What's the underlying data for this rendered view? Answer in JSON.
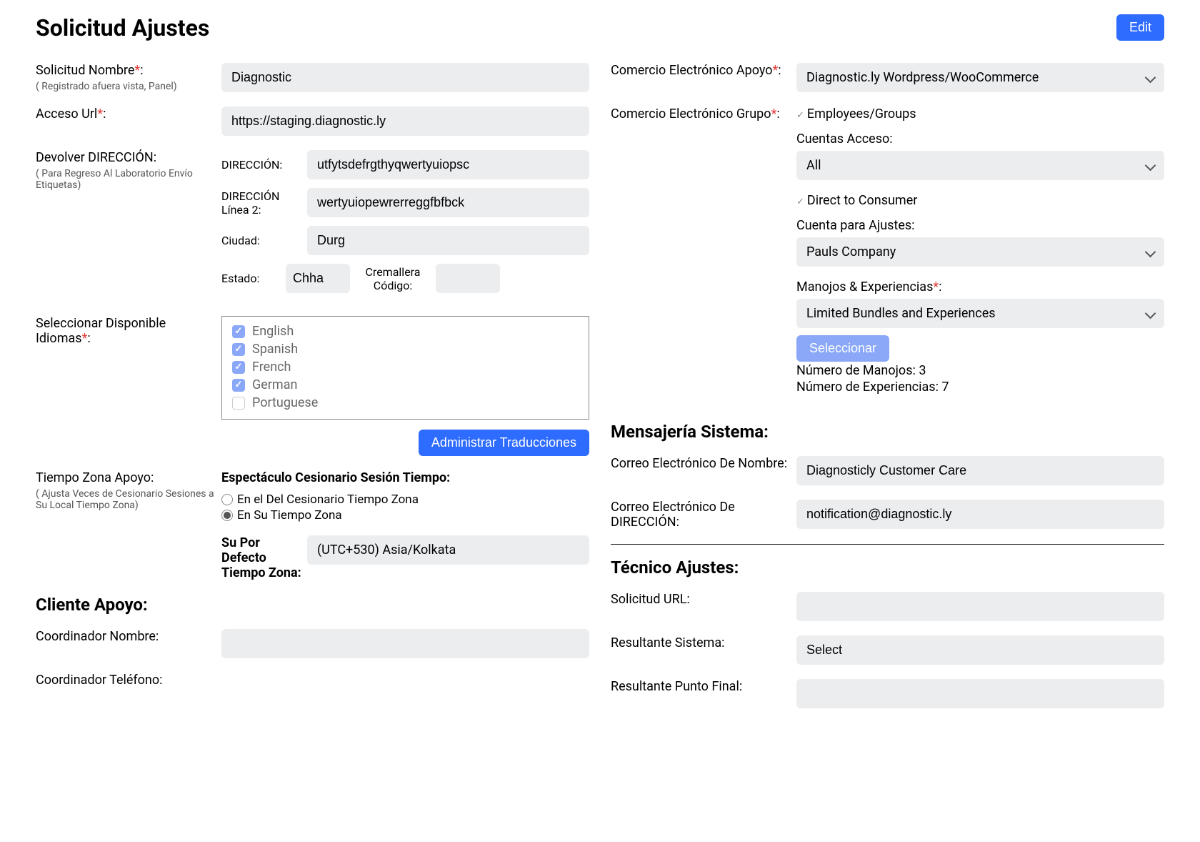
{
  "header": {
    "title": "Solicitud Ajustes",
    "edit_label": "Edit"
  },
  "left": {
    "name_label": "Solicitud Nombre",
    "name_sub": "( Registrado afuera vista, Panel)",
    "name_value": "Diagnostic",
    "url_label": "Acceso Url",
    "url_value": "https://staging.diagnostic.ly",
    "return_label": "Devolver DIRECCIÓN:",
    "return_sub": "( Para Regreso Al Laboratorio Envío Etiquetas)",
    "addr1_label": "DIRECCIÓN:",
    "addr1_value": "utfytsdefrgthyqwertyuiopsc",
    "addr2_label": "DIRECCIÓN Línea 2:",
    "addr2_value": "wertyuiopewrerreggfbfbck",
    "city_label": "Ciudad:",
    "city_value": "Durg",
    "state_label": "Estado:",
    "state_value": "Chha",
    "zip_label": "Cremallera Código:",
    "zip_value": "",
    "langs_label": "Seleccionar Disponible Idiomas",
    "languages": [
      {
        "label": "English",
        "checked": true
      },
      {
        "label": "Spanish",
        "checked": true
      },
      {
        "label": "French",
        "checked": true
      },
      {
        "label": "German",
        "checked": true
      },
      {
        "label": "Portuguese",
        "checked": false
      }
    ],
    "manage_translations": "Administrar Traducciones",
    "tz_support_label": "Tiempo Zona Apoyo:",
    "tz_support_sub": "( Ajusta Veces de Cesionario Sesiones a Su Local Tiempo Zona)",
    "show_assignee_label": "Espectáculo Cesionario Sesión Tiempo:",
    "radio_assignee_tz": "En el Del Cesionario Tiempo Zona",
    "radio_your_tz": "En Su Tiempo Zona",
    "default_tz_label": "Su Por Defecto Tiempo Zona:",
    "default_tz_value": "(UTC+530) Asia/Kolkata",
    "client_section": "Cliente Apoyo:",
    "coord_name_label": "Coordinador Nombre:",
    "coord_name_value": "",
    "coord_phone_label": "Coordinador Teléfono:"
  },
  "right": {
    "ecom_support_label": "Comercio Electrónico Apoyo",
    "ecom_support_value": "Diagnostic.ly Wordpress/WooCommerce",
    "ecom_group_label": "Comercio Electrónico Grupo",
    "emp_groups_label": "Employees/Groups",
    "accounts_access_label": "Cuentas Acceso:",
    "accounts_access_value": "All",
    "d2c_label": "Direct to Consumer",
    "account_settings_label": "Cuenta para Ajustes:",
    "account_settings_value": "Pauls Company",
    "bundles_label": "Manojos & Experiencias",
    "bundles_value": "Limited Bundles and Experiences",
    "select_btn": "Seleccionar",
    "bundles_count_label": "Número de Manojos: ",
    "bundles_count": "3",
    "exp_count_label": "Número de Experiencias: ",
    "exp_count": "7",
    "messaging_section": "Mensajería Sistema:",
    "email_name_label": "Correo Electrónico De Nombre:",
    "email_name_value": "Diagnosticly Customer Care",
    "email_addr_label": "Correo Electrónico De DIRECCIÓN:",
    "email_addr_value": "notification@diagnostic.ly",
    "tech_section": "Técnico Ajustes:",
    "app_url_label": "Solicitud URL:",
    "app_url_value": "",
    "resulting_system_label": "Resultante Sistema:",
    "resulting_system_value": "Select",
    "resulting_endpoint_label": "Resultante Punto Final:",
    "resulting_endpoint_value": ""
  }
}
